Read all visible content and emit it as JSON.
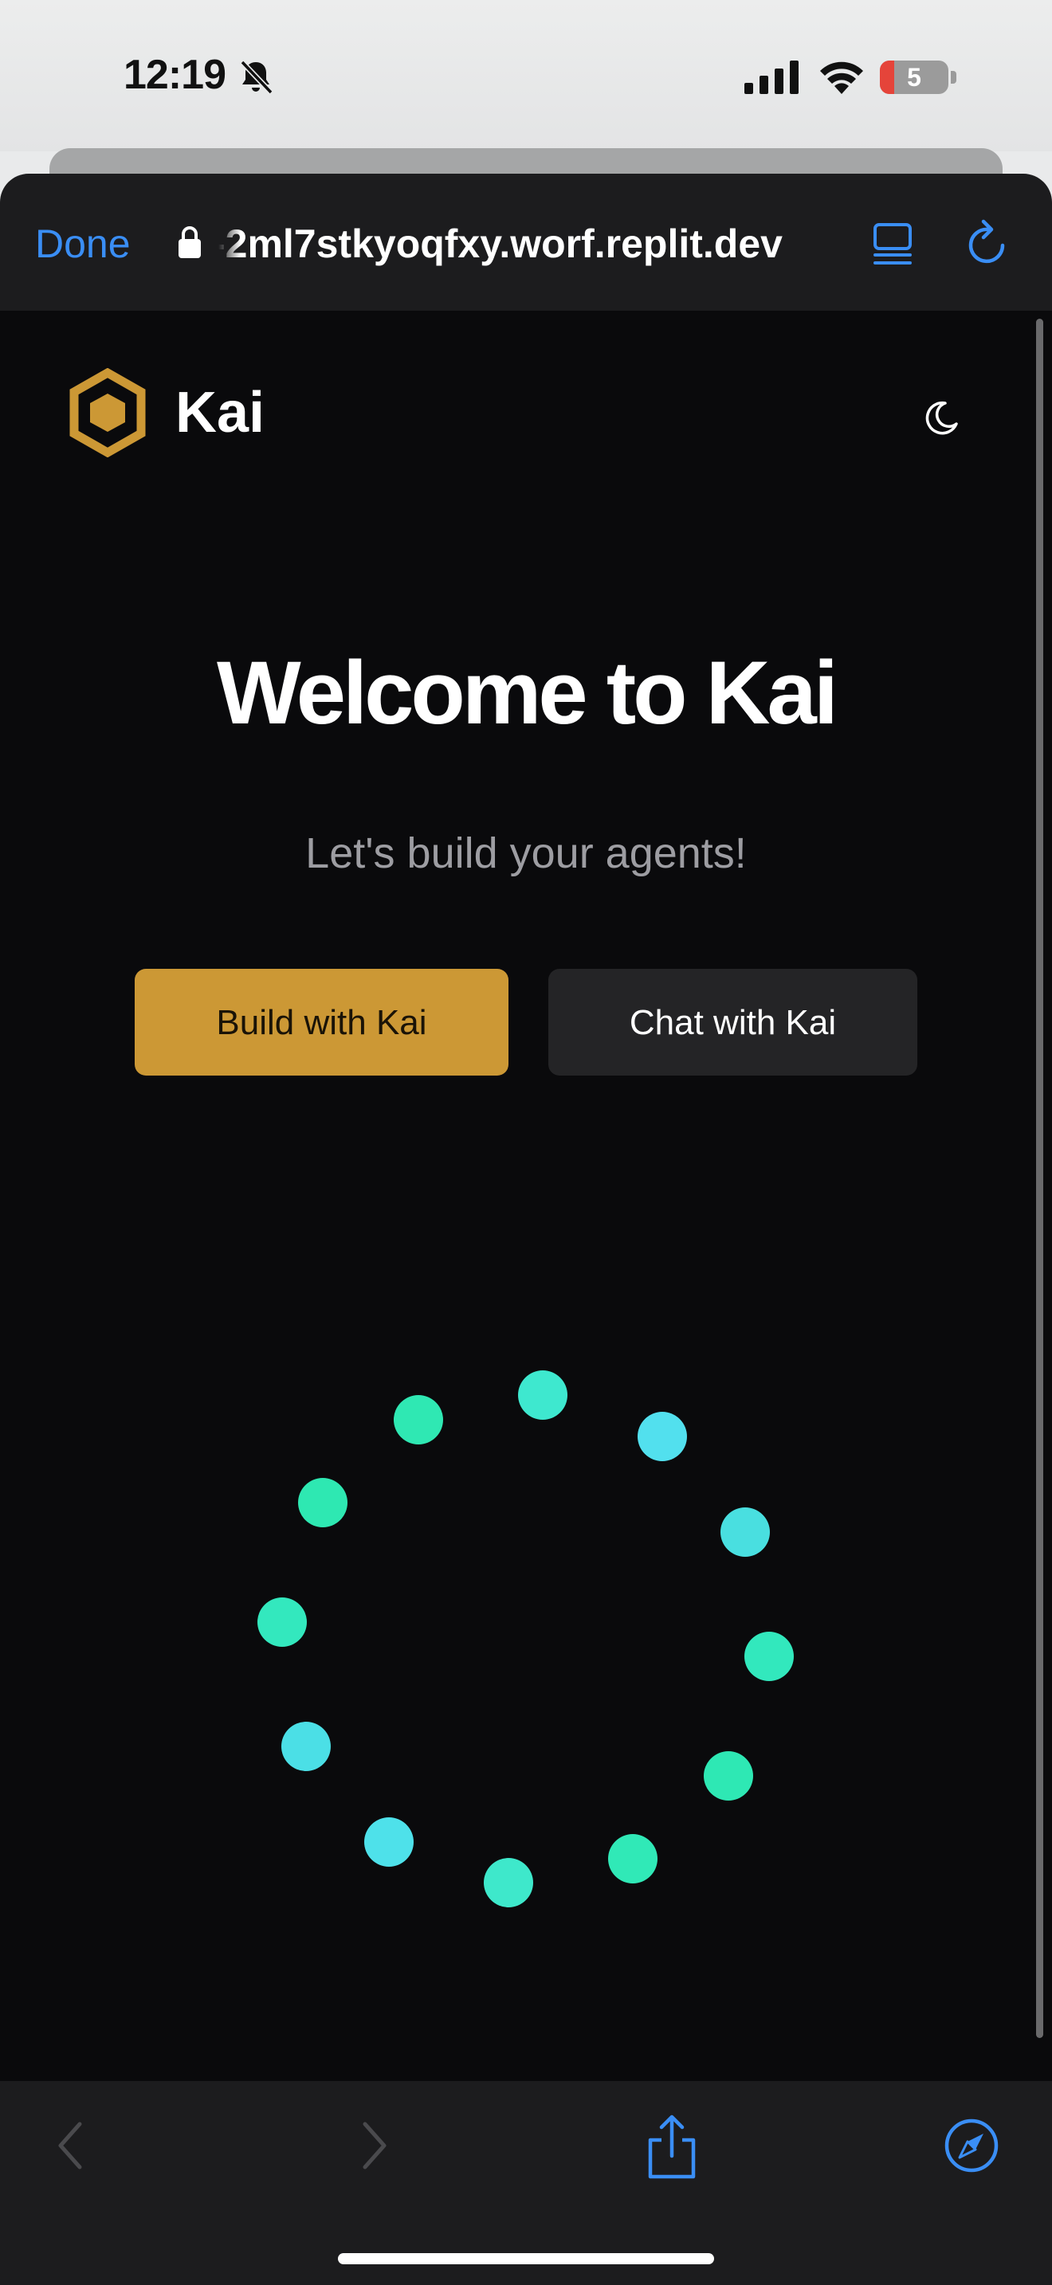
{
  "status_bar": {
    "time": "12:19",
    "battery_level": "5",
    "icons": [
      "bell-slash-icon",
      "cellular-signal-icon",
      "wifi-icon",
      "battery-icon"
    ]
  },
  "browser": {
    "done_label": "Done",
    "url": "-2ml7stkyoqfxy.worf.replit.dev",
    "icons": [
      "lock-icon",
      "reader-view-icon",
      "reload-icon"
    ],
    "accent_color": "#3a8ef5"
  },
  "app": {
    "brand_name": "Kai",
    "logo_icon": "hexagon-logo-icon",
    "theme_toggle_icon": "moon-icon",
    "title": "Welcome to Kai",
    "subtitle": "Let's build your agents!",
    "primary_button": "Build with Kai",
    "secondary_button": "Chat with Kai",
    "brand_color": "#cc9835",
    "spinner": {
      "icon": "loading-spinner-icon",
      "dot_count": 12,
      "colors": [
        "#3ee8c4",
        "#4fdde9",
        "#2ee8b4"
      ]
    }
  },
  "bottom_bar": {
    "icons": [
      "back-icon",
      "forward-icon",
      "share-icon",
      "safari-compass-icon"
    ]
  }
}
